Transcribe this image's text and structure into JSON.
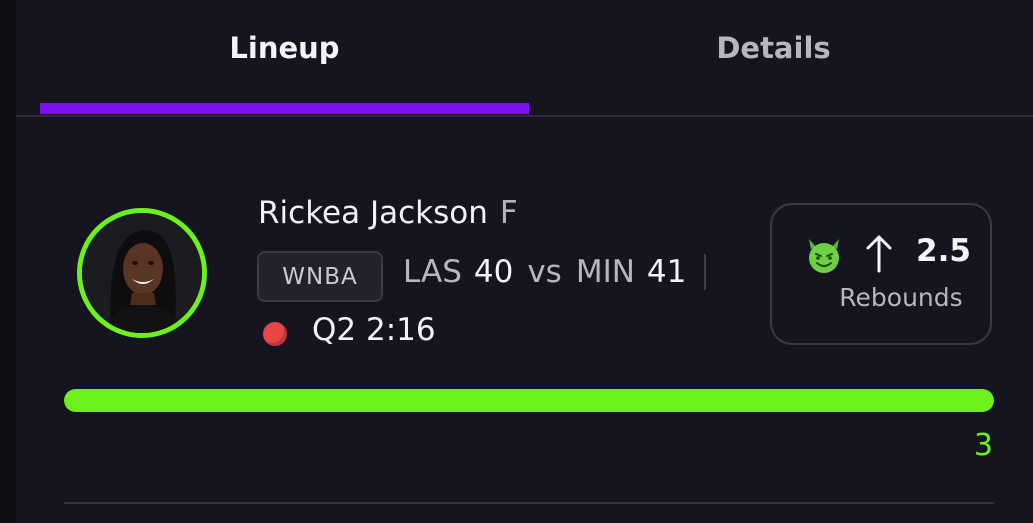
{
  "tabs": [
    {
      "label": "Lineup",
      "active": true
    },
    {
      "label": "Details",
      "active": false
    }
  ],
  "colors": {
    "accent": "#7a12f0",
    "success": "#6cf11c",
    "live": "#e84545"
  },
  "player": {
    "name": "Rickea Jackson",
    "position": "F",
    "league": "WNBA",
    "matchup": {
      "team1": "LAS",
      "score1": "40",
      "vs": "vs",
      "team2": "MIN",
      "score2": "41"
    },
    "clock": "Q2 2:16",
    "status_icon": "live-dot-icon"
  },
  "pick": {
    "icon": "devil-icon",
    "direction_icon": "arrow-up-icon",
    "line": "2.5",
    "stat": "Rebounds"
  },
  "progress": {
    "current": "3",
    "fraction": 1.0
  }
}
